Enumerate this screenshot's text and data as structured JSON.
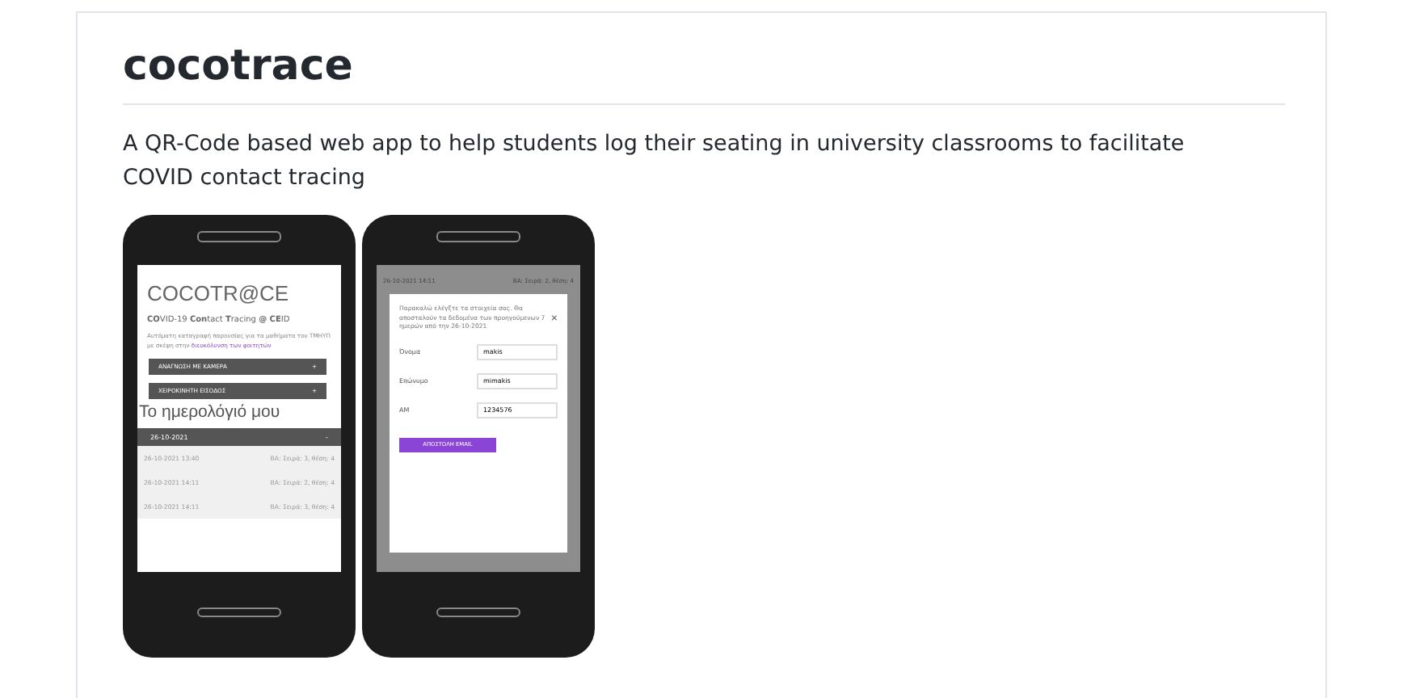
{
  "page": {
    "title": "cocotrace",
    "description": "A QR-Code based web app to help students log their seating in university classrooms to facilitate COVID contact tracing"
  },
  "phones": [
    {
      "kind": "home",
      "app_title": "COCOTR@CE",
      "subtitle": "**CO**VID-19 **Con**tact **T**racing **@ CE**ID",
      "intro": "Αυτόματη καταγραφή παρουσίας για τα μαθήματα του ΤΜΗΥΠ με σκέψη στην",
      "intro_link": "διευκόλυνση των φοιτητών",
      "buttons": [
        {
          "label": "ΑΝΑΓΝΩΣΗ ΜΕ ΚΑΜΕΡΑ",
          "icon": "+"
        },
        {
          "label": "ΧΕΙΡΟΚΙΝΗΤΗ ΕΙΣΟΔΟΣ",
          "icon": "+"
        }
      ],
      "diary_title": "Το ημερολόγιό μου",
      "diary_date": "26-10-2021",
      "diary_toggle": "-",
      "entries": [
        {
          "time": "26-10-2021 13:40",
          "seat": "ΒΑ: Σειρά: 3, θέση: 4"
        },
        {
          "time": "26-10-2021 14:11",
          "seat": "ΒΑ: Σειρά: 2, θέση: 4"
        },
        {
          "time": "26-10-2021 14:11",
          "seat": "ΒΑ: Σειρά: 3, θέση: 4"
        }
      ]
    },
    {
      "kind": "dialog",
      "header_time": "26-10-2021 14:11",
      "header_seat": "ΒΑ: Σειρά: 2, θέση: 4",
      "message": "Παρακαλώ ελέγξτε τα στοιχεία σας. Θα αποσταλούν τα δεδομένα των προηγούμενων 7 ημερών από την 26-10-2021",
      "close": "×",
      "fields": [
        {
          "label": "Όνομα",
          "value": "makis"
        },
        {
          "label": "Επώνυμο",
          "value": "mimakis"
        },
        {
          "label": "ΑΜ",
          "value": "1234576"
        }
      ],
      "submit": "ΑΠΟΣΤΟΛΗ EMAIL"
    }
  ]
}
